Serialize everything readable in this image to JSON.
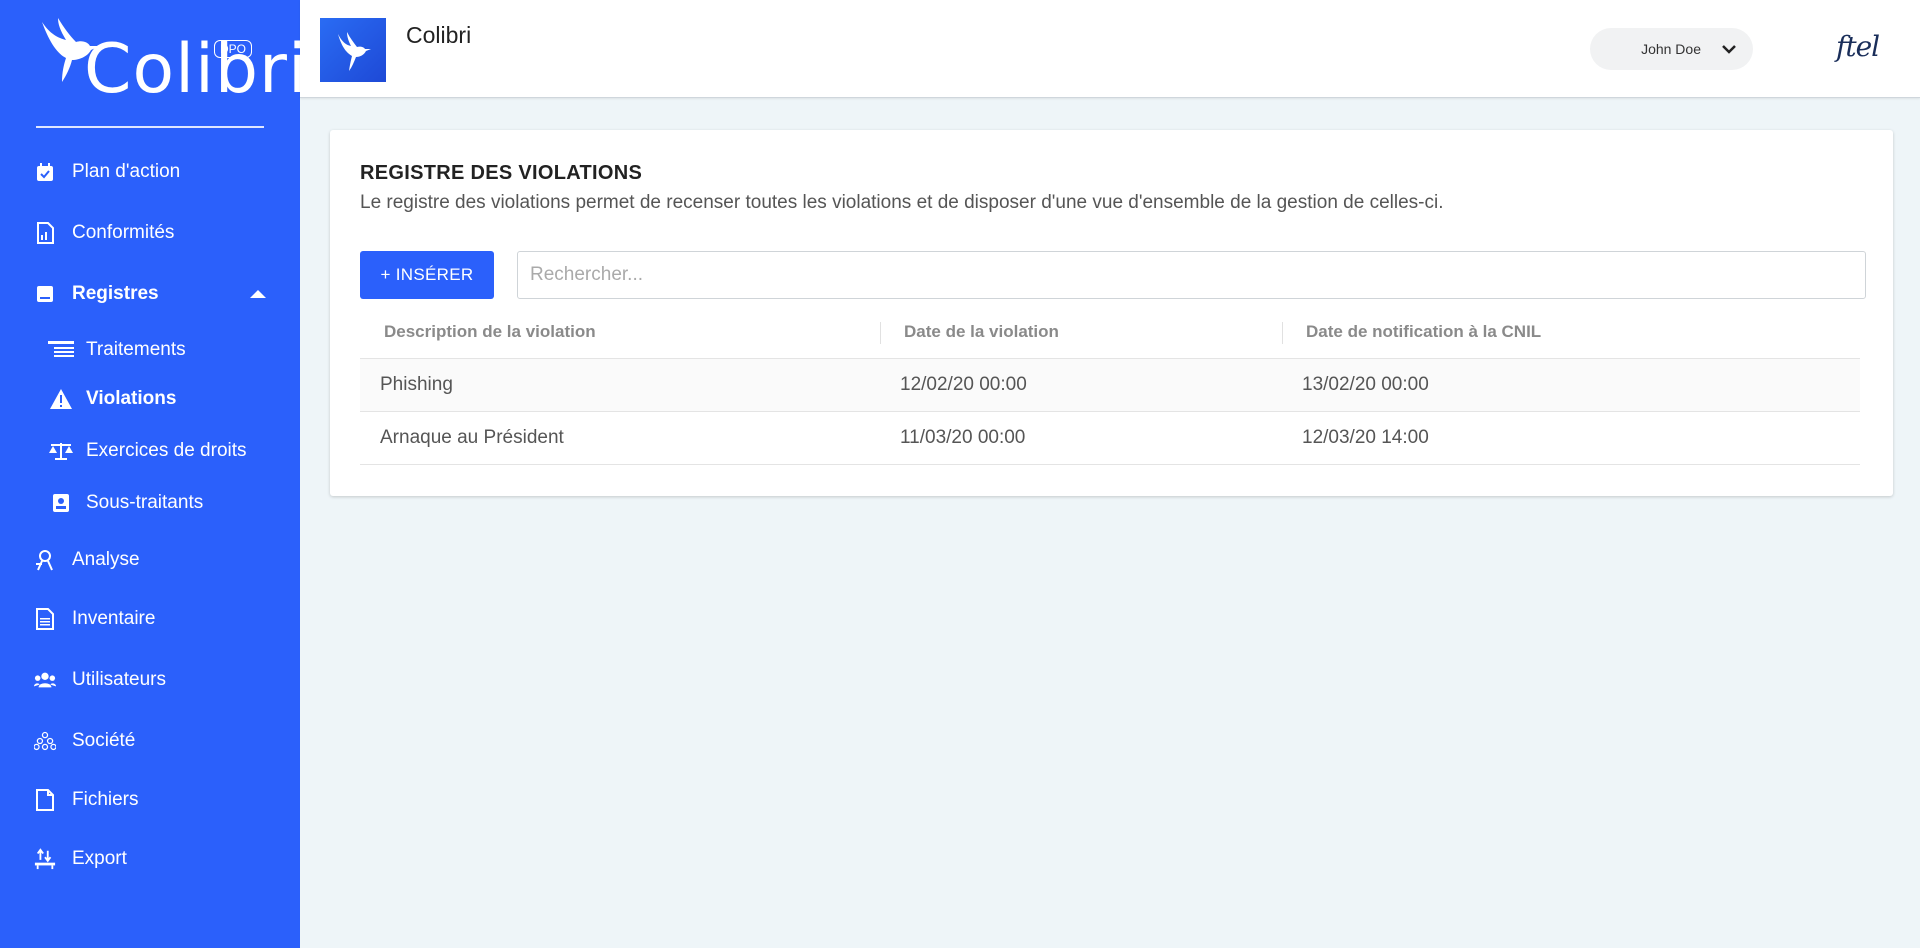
{
  "brand": {
    "name": "Colibri",
    "badge": "DPO"
  },
  "sidebar": {
    "items": [
      {
        "label": "Plan d'action",
        "icon": "calendar-check-icon"
      },
      {
        "label": "Conformités",
        "icon": "file-chart-icon"
      },
      {
        "label": "Registres",
        "icon": "book-icon",
        "expanded": true
      },
      {
        "label": "Analyse",
        "icon": "chart-person-icon"
      },
      {
        "label": "Inventaire",
        "icon": "document-icon"
      },
      {
        "label": "Utilisateurs",
        "icon": "users-icon"
      },
      {
        "label": "Société",
        "icon": "company-icon"
      },
      {
        "label": "Fichiers",
        "icon": "file-icon"
      },
      {
        "label": "Export",
        "icon": "export-icon"
      }
    ],
    "registres_sub": [
      {
        "label": "Traitements",
        "icon": "list-icon"
      },
      {
        "label": "Violations",
        "icon": "warning-icon",
        "active": true
      },
      {
        "label": "Exercices de droits",
        "icon": "balance-icon"
      },
      {
        "label": "Sous-traitants",
        "icon": "contact-icon"
      }
    ]
  },
  "topbar": {
    "title": "Colibri",
    "user_name": "John Doe",
    "partner_logo": "ftel"
  },
  "main": {
    "title": "REGISTRE DES VIOLATIONS",
    "description": "Le registre des violations permet de recenser toutes les violations et de disposer d'une vue d'ensemble de la gestion de celles-ci.",
    "insert_label": "+ INSÉRER",
    "search_placeholder": "Rechercher...",
    "columns": [
      "Description de la violation",
      "Date de la violation",
      "Date de notification à la CNIL"
    ],
    "rows": [
      [
        "Phishing",
        "12/02/20 00:00",
        "13/02/20 00:00"
      ],
      [
        "Arnaque au Président",
        "11/03/20 00:00",
        "12/03/20 14:00"
      ]
    ]
  },
  "colors": {
    "accent": "#2b60fb",
    "background": "#eef5f8"
  }
}
